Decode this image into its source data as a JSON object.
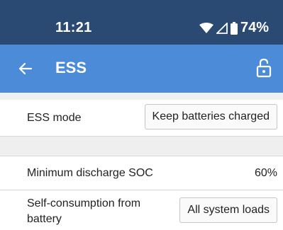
{
  "status_bar": {
    "time": "11:21",
    "battery_percent": "74%",
    "icons": [
      "wifi-icon",
      "signal-icon",
      "battery-icon"
    ],
    "color": "#2b4a73"
  },
  "app_bar": {
    "title": "ESS",
    "back_icon": "arrow-left-icon",
    "lock_icon": "unlocked-padlock-icon",
    "color": "#4b8bd8"
  },
  "settings": {
    "ess_mode": {
      "label": "ESS mode",
      "value": "Keep batteries charged"
    },
    "min_discharge_soc": {
      "label": "Minimum discharge SOC",
      "value": "60%"
    },
    "self_consumption": {
      "label_line1": "Self-consumption from",
      "label_line2": "battery",
      "value": "All system loads"
    }
  }
}
